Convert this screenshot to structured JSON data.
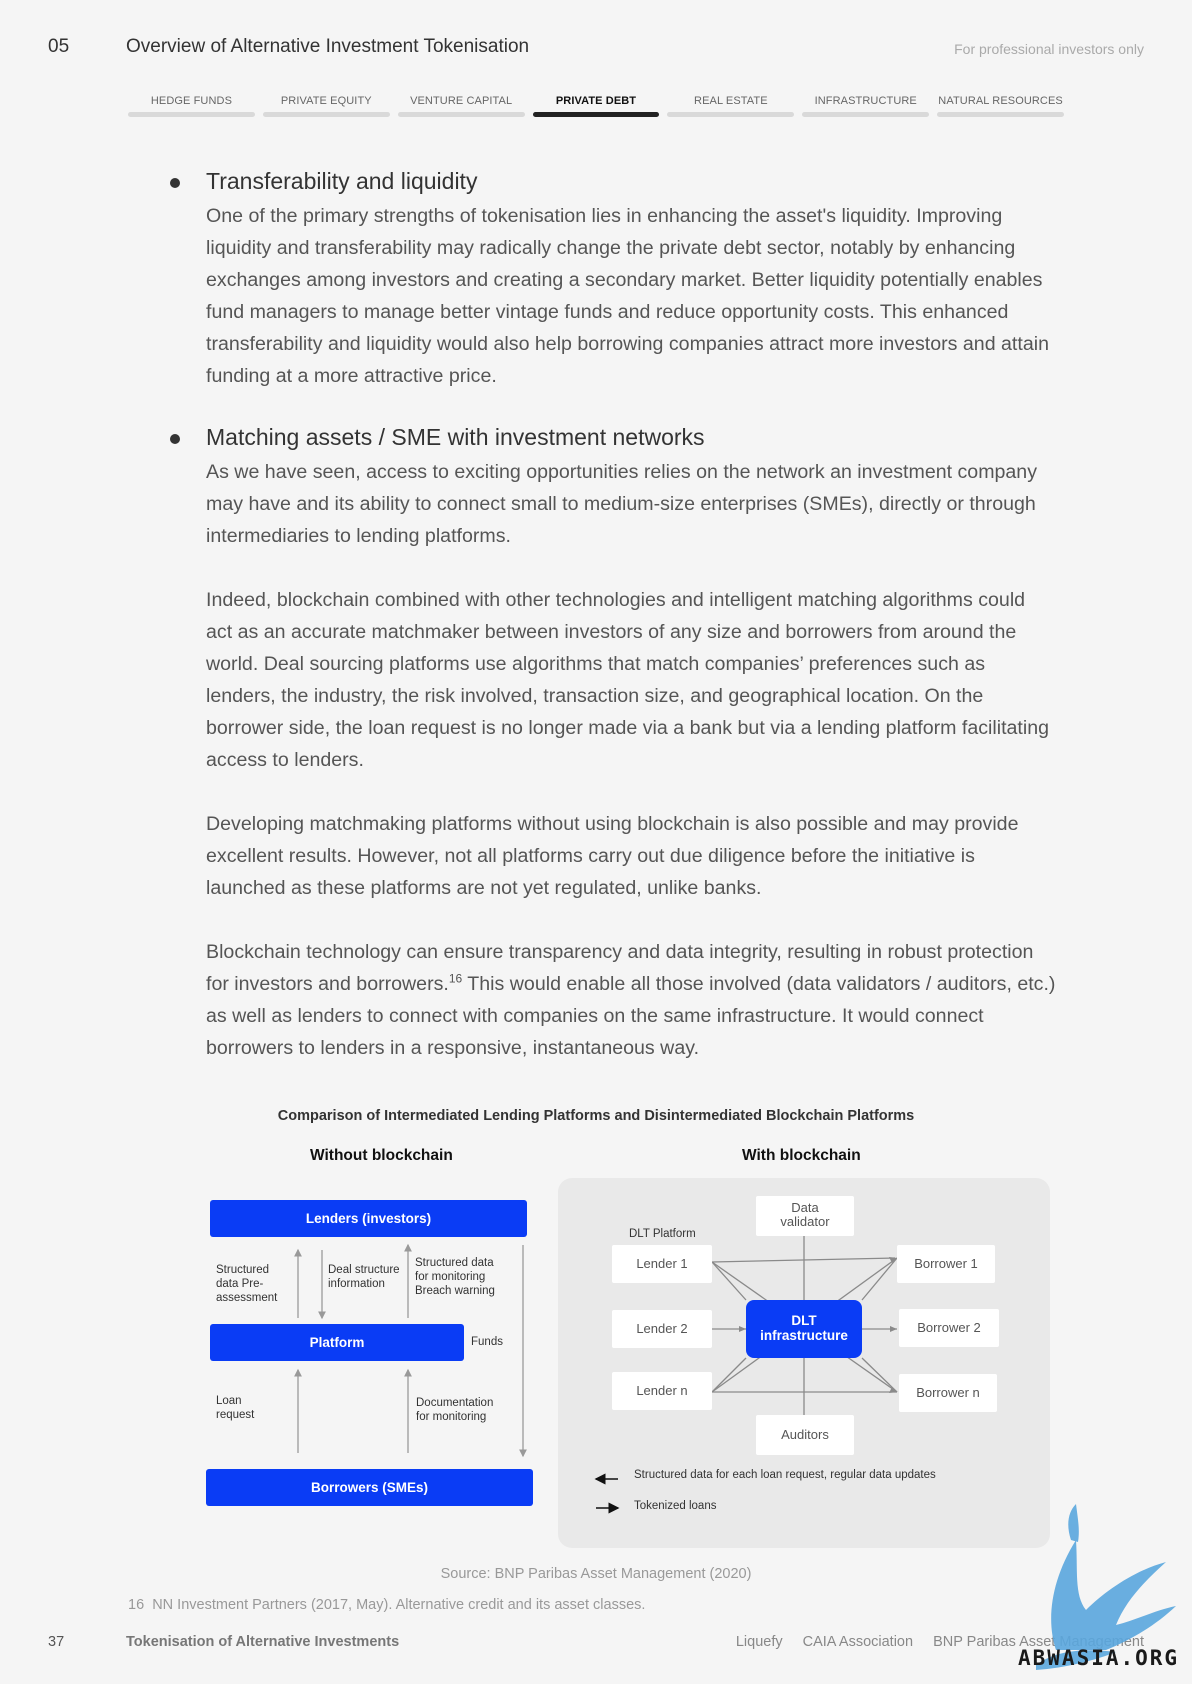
{
  "header": {
    "chapter_number": "05",
    "chapter_title": "Overview of Alternative Investment Tokenisation",
    "audience_note": "For professional investors only"
  },
  "tabs": [
    {
      "label": "HEDGE FUNDS",
      "active": false
    },
    {
      "label": "PRIVATE EQUITY",
      "active": false
    },
    {
      "label": "VENTURE CAPITAL",
      "active": false
    },
    {
      "label": "PRIVATE DEBT",
      "active": true
    },
    {
      "label": "REAL ESTATE",
      "active": false
    },
    {
      "label": "INFRASTRUCTURE",
      "active": false
    },
    {
      "label": "NATURAL RESOURCES",
      "active": false
    }
  ],
  "sections": {
    "transferability": {
      "title": "Transferability and liquidity",
      "paragraph": "One of the primary strengths of tokenisation lies in enhancing the asset's liquidity. Improving liquidity and transferability may radically change the private debt sector, notably by enhancing exchanges among investors and creating a secondary market. Better liquidity potentially enables fund managers to manage better vintage funds and reduce opportunity costs. This enhanced transferability and liquidity would also help borrowing companies attract more investors and attain funding at a more attractive price."
    },
    "matching": {
      "title": "Matching assets / SME  with investment networks",
      "paragraph_1": "As we have seen, access to exciting opportunities relies on the network an investment company may have and its ability to connect small to medium-size enterprises (SMEs), directly or through intermediaries to lending platforms.",
      "paragraph_2": "Indeed, blockchain combined with other technologies and intelligent matching algorithms could act as an accurate matchmaker between investors of any size and borrowers from around the world. Deal sourcing platforms use algorithms that match companies’ preferences such as lenders, the industry, the risk involved, transaction size, and geographical location. On the borrower side, the loan request is no longer made via a bank but via a lending platform facilitating access to lenders.",
      "paragraph_3": "Developing matchmaking platforms without using blockchain is also possible and may provide excellent results. However, not all platforms carry out due diligence before the initiative is launched as these platforms are not yet regulated, unlike banks.",
      "paragraph_4_part1": "Blockchain technology can ensure transparency and data integrity, resulting in robust protection for investors and borrowers.",
      "paragraph_4_footnote_ref": "16",
      "paragraph_4_part2": " This would enable all those involved (data validators / auditors, etc.) as well as lenders to connect with companies on the same infrastructure. It would connect borrowers to lenders in a responsive, instantaneous way."
    }
  },
  "figure": {
    "title": "Comparison of Intermediated Lending Platforms and Disintermediated Blockchain Platforms",
    "left": {
      "heading": "Without blockchain",
      "lenders": "Lenders (investors)",
      "platform": "Platform",
      "borrowers": "Borrowers (SMEs)",
      "label_structured_pre": "Structured\ndata Pre-\nassessment",
      "label_deal_structure": "Deal structure\ninformation",
      "label_structured_monitoring": "Structured data\nfor monitoring\nBreach warning",
      "label_funds": "Funds",
      "label_loan_request": "Loan\nrequest",
      "label_documentation": "Documentation\nfor monitoring"
    },
    "right": {
      "heading": "With blockchain",
      "dlt_platform": "DLT Platform",
      "data_validator": "Data\nvalidator",
      "lender_1": "Lender 1",
      "lender_2": "Lender 2",
      "lender_n": "Lender n",
      "borrower_1": "Borrower 1",
      "borrower_2": "Borrower 2",
      "borrower_n": "Borrower n",
      "dlt_infrastructure": "DLT\ninfrastructure",
      "auditors": "Auditors",
      "legend_1": "Structured data for each loan request, regular data updates",
      "legend_2": "Tokenized loans"
    },
    "source": "Source: BNP Paribas Asset Management (2020)"
  },
  "footnote": {
    "number": "16",
    "text": "NN Investment Partners (2017, May). Alternative credit and its asset classes."
  },
  "footer": {
    "page_number": "37",
    "document_title": "Tokenisation of Alternative Investments",
    "partners": [
      "Liquefy",
      "CAIA Association",
      "BNP Paribas Asset Management"
    ]
  },
  "watermark": {
    "text": "ABWASIA.ORG"
  },
  "colors": {
    "accent_blue": "#0a3cf5",
    "active_tab": "#222222",
    "inactive_tab": "#d9d9d9",
    "watermark_blue": "#5aa7de"
  }
}
